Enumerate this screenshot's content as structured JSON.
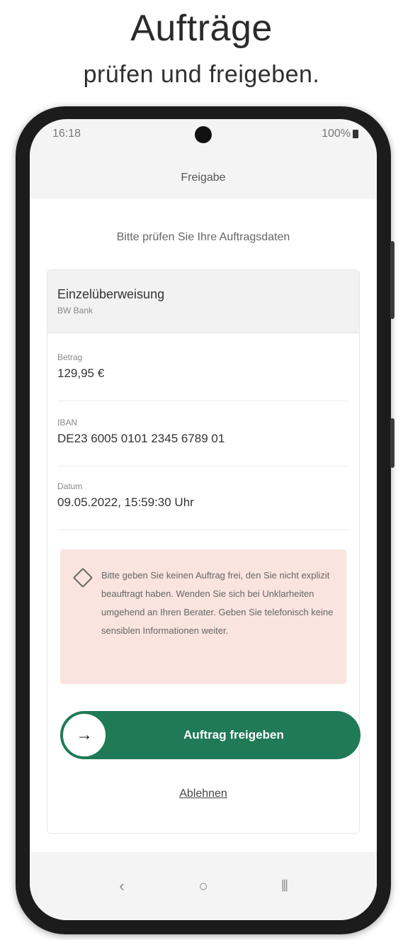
{
  "promo": {
    "title": "Aufträge",
    "subtitle": "prüfen und freigeben."
  },
  "statusbar": {
    "time": "16:18",
    "battery": "100%",
    "battery_icon": "battery-full-icon"
  },
  "header": {
    "title": "Freigabe"
  },
  "content": {
    "prompt": "Bitte prüfen Sie Ihre Auftragsdaten"
  },
  "order": {
    "type": "Einzelüberweisung",
    "bank": "BW Bank",
    "amount_label": "Betrag",
    "amount_value": "129,95 €",
    "iban_label": "IBAN",
    "iban_value": "DE23 6005 0101 2345 6789 01",
    "date_label": "Datum",
    "date_value": "09.05.2022, 15:59:30 Uhr"
  },
  "warning": {
    "icon": "warning-diamond-icon",
    "text": "Bitte geben Sie keinen Auftrag frei, den Sie nicht explizit beauftragt haben. Wenden Sie sich bei Unklarheiten umgehend an Ihren Berater. Geben Sie telefonisch keine sensiblen Informationen weiter."
  },
  "actions": {
    "approve_label": "Auftrag freigeben",
    "approve_icon": "arrow-right-icon",
    "reject_label": "Ablehnen"
  },
  "navbar": {
    "back_icon": "back-icon",
    "home_icon": "home-icon",
    "recents_icon": "recents-icon",
    "back_glyph": "‹",
    "home_glyph": "○",
    "recents_glyph": "⦀"
  },
  "colors": {
    "accent": "#1f7a55",
    "warning_bg": "#f9e4df"
  }
}
